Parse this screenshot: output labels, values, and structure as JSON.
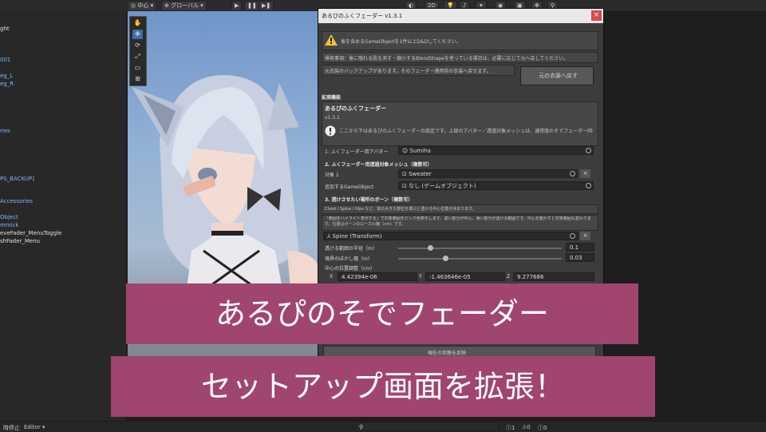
{
  "toolbar": {
    "pivot": "中心",
    "global": "グローバル",
    "mode_2d": "2D",
    "play_icons": [
      "play-icon",
      "pause-icon",
      "step-icon"
    ]
  },
  "hierarchy": {
    "items": [
      {
        "text": "ght",
        "style": "w"
      },
      {
        "text": "001",
        "style": "b"
      },
      {
        "text": "eg_L",
        "style": "b"
      },
      {
        "text": "eg_R",
        "style": "b"
      },
      {
        "text": "ries",
        "style": "b"
      },
      {
        "text": "PS_BACKUP]",
        "style": "b"
      },
      {
        "text": "Accessories",
        "style": "b"
      },
      {
        "text": "Object",
        "style": "b"
      },
      {
        "text": "mmick",
        "style": "b"
      },
      {
        "text": "eveFader_MenuToggle",
        "style": "w"
      },
      {
        "text": "shFader_Menu",
        "style": "w"
      }
    ]
  },
  "window": {
    "title": "あるぴのふくフェーダー v1.3.1",
    "close": "×",
    "warning": "後を含めるGameObjectを1件以上D&Dしてください。",
    "note": "揮発事項：後に隠れる肌を消す・縮小するBlendShapeを使っている場合は、必要に応じて元へ戻してください。",
    "backup_text": "元衣装のバックアップがあります。そのフェーダー適用前の衣装へ戻せます。",
    "restore_button": "元の衣装へ戻す",
    "ext_section": "拡張機能",
    "ext_title": "あるぴのふくフェーダー",
    "ext_version": "v1.3.1",
    "ext_info": "ここから下はあるぴのふくフェーダーの設定です。上部のアバター／透過対象メッシュは、通常版のそでフェーダー同様に指定してください。",
    "s1_label": "1. ふくフェーダー用アバター",
    "s1_value": "Sumiha",
    "s2_title": "2. ふくフェーダー用透過対象メッシュ（複数可）",
    "s2_target_label": "対象 1",
    "s2_target_value": "Sweater",
    "s2_add_label": "追加するGameObject",
    "s2_add_value": "なし (ゲームオブジェクト)",
    "s3_title": "3. 透けさせたい場所のボーン（複数可）",
    "s3_hint": "Chest / Spine / Hips など、体の大きな部位を選ぶと透ける中心位置が決まります。",
    "s3_desc": "「範囲をハイライト表示する」で対象範囲をピンク色表示します。濃い部分が中心、薄い部分が透ける範囲です。中心を動かすと対象範囲も変わります。位置はボーンのローカル軸（cm）です。",
    "bone_value": "Spine (Transform)",
    "radius_label": "透ける範囲の半径（m）",
    "radius_value": "0.1",
    "blur_label": "境界のぼかし幅（m）",
    "blur_value": "0.03",
    "offset_label": "中心の位置調整（cm）",
    "x_label": "X",
    "x_value": "4.42394e-06",
    "y_label": "Y",
    "y_value": "-1.463646e-05",
    "z_label": "Z",
    "z_value": "9.277686",
    "bottom_button": "現在の状態を反映"
  },
  "bottombar": {
    "left_text": "時停止",
    "editor": "Editor",
    "count1": "1",
    "count2": "0",
    "count3": "0"
  },
  "captions": {
    "line1": "あるぴのそでフェーダー",
    "line2": "セットアップ画面を拡張！"
  },
  "colors": {
    "caption_bg": "#a0456f",
    "close_btn": "#d84a4a"
  }
}
